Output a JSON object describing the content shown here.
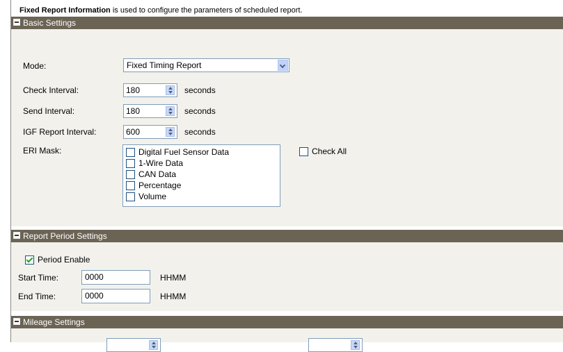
{
  "intro": {
    "bold": "Fixed Report Information",
    "rest": " is used to configure the parameters of scheduled report."
  },
  "basic": {
    "title": "Basic Settings",
    "mode_label": "Mode:",
    "mode_value": "Fixed Timing Report",
    "check_label": "Check Interval:",
    "check_value": "180",
    "send_label": "Send Interval:",
    "send_value": "180",
    "igf_label": "IGF Report Interval:",
    "igf_value": "600",
    "unit": "seconds",
    "eri_label": "ERI Mask:",
    "eri_items": [
      "Digital Fuel Sensor Data",
      "1-Wire Data",
      "CAN Data",
      "Percentage",
      "Volume"
    ],
    "check_all": "Check All"
  },
  "period": {
    "title": "Report Period Settings",
    "enable_label": "Period Enable",
    "enable_checked": true,
    "start_label": "Start Time:",
    "start_value": "0000",
    "end_label": "End Time:",
    "end_value": "0000",
    "unit": "HHMM"
  },
  "mileage": {
    "title": "Mileage Settings"
  }
}
